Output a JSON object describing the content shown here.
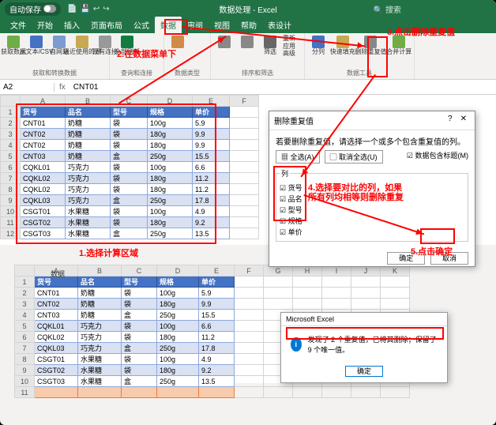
{
  "app": {
    "autosave": "自动保存",
    "doc_title": "数据处理 - Excel",
    "search": "搜索"
  },
  "tabs": {
    "file": "文件",
    "home": "开始",
    "insert": "插入",
    "layout": "页面布局",
    "formula": "公式",
    "data": "数据",
    "review": "审阅",
    "view": "视图",
    "help": "帮助",
    "design": "表设计"
  },
  "ribbon": {
    "g1_items": [
      "获取数据",
      "从文本/CSV",
      "自网站",
      "最近使用的源",
      "现有连接"
    ],
    "g1_label": "获取和转换数据",
    "g2_items": [
      "全部刷新",
      "查询和连接"
    ],
    "g2_tag": "2.在数据菜单下",
    "g2_label": "查询和连接",
    "g3_label": "数据类型",
    "g4_label": "排序和筛选",
    "g4_items": [
      "筛选",
      "重新应用",
      "高级"
    ],
    "g5_items": [
      "分列",
      "快速填充",
      "删除重复值",
      "数据验证",
      "合并计算"
    ],
    "g5_label": "数据工具"
  },
  "formula": {
    "name": "A2",
    "fx": "fx",
    "val": "CNT01"
  },
  "cols": [
    "A",
    "B",
    "C",
    "D",
    "E",
    "F",
    "G",
    "H",
    "I",
    "J",
    "K"
  ],
  "headers": [
    "货号",
    "品名",
    "型号",
    "规格",
    "单价"
  ],
  "rows": [
    [
      "CNT01",
      "奶糖",
      "袋",
      "100g",
      "5.9"
    ],
    [
      "CNT02",
      "奶糖",
      "袋",
      "180g",
      "9.9"
    ],
    [
      "CNT02",
      "奶糖",
      "袋",
      "180g",
      "9.9"
    ],
    [
      "CNT03",
      "奶糖",
      "盒",
      "250g",
      "15.5"
    ],
    [
      "CQKL01",
      "巧克力",
      "袋",
      "100g",
      "6.6"
    ],
    [
      "CQKL02",
      "巧克力",
      "袋",
      "180g",
      "11.2"
    ],
    [
      "CQKL02",
      "巧克力",
      "袋",
      "180g",
      "11.2"
    ],
    [
      "CQKL03",
      "巧克力",
      "盒",
      "250g",
      "17.8"
    ],
    [
      "CSGT01",
      "水果糖",
      "袋",
      "100g",
      "4.9"
    ],
    [
      "CSGT02",
      "水果糖",
      "袋",
      "180g",
      "9.2"
    ],
    [
      "CSGT03",
      "水果糖",
      "盒",
      "250g",
      "13.5"
    ]
  ],
  "rows2": [
    [
      "CNT01",
      "奶糖",
      "袋",
      "100g",
      "5.9"
    ],
    [
      "CNT02",
      "奶糖",
      "袋",
      "180g",
      "9.9"
    ],
    [
      "CNT03",
      "奶糖",
      "盒",
      "250g",
      "15.5"
    ],
    [
      "CQKL01",
      "巧克力",
      "袋",
      "100g",
      "6.6"
    ],
    [
      "CQKL02",
      "巧克力",
      "袋",
      "180g",
      "11.2"
    ],
    [
      "CQKL03",
      "巧克力",
      "盒",
      "250g",
      "17.8"
    ],
    [
      "CSGT01",
      "水果糖",
      "袋",
      "100g",
      "4.9"
    ],
    [
      "CSGT02",
      "水果糖",
      "袋",
      "180g",
      "9.2"
    ],
    [
      "CSGT03",
      "水果糖",
      "盒",
      "250g",
      "13.5"
    ]
  ],
  "dialog": {
    "title": "删除重复值",
    "desc": "若要删除重复值，请选择一个或多个包含重复值的列。",
    "select_all": "全选(A)",
    "unselect_all": "取消全选(U)",
    "has_header": "数据包含标题(M)",
    "col_label": "列",
    "cols": [
      "货号",
      "品名",
      "型号",
      "规格",
      "单价"
    ],
    "ok": "确定",
    "cancel": "取消"
  },
  "msg": {
    "title": "Microsoft Excel",
    "text": "发现了 2 个重复值，已将其删除；保留了 9 个唯一值。",
    "ok": "确定"
  },
  "ann": {
    "a1": "1.选择计算区域",
    "a2": "2.在数据菜单下",
    "a3": "3.点击删除重复值",
    "a4a": "4.选择要对比的列，如果",
    "a4b": "所有列均相等则删除重复",
    "a5": "5.点击确定"
  },
  "lower_label": "数据"
}
